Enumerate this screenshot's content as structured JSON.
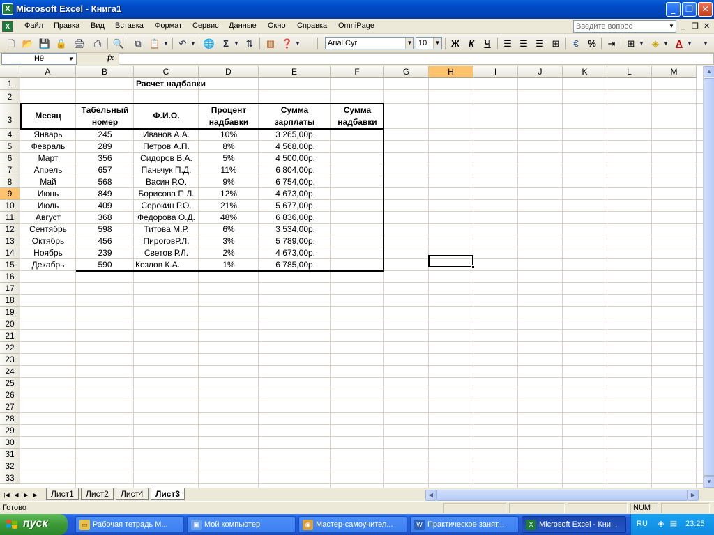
{
  "window": {
    "title": "Microsoft Excel - Книга1",
    "app_icon": "excel-icon"
  },
  "menu": {
    "items": [
      "Файл",
      "Правка",
      "Вид",
      "Вставка",
      "Формат",
      "Сервис",
      "Данные",
      "Окно",
      "Справка",
      "OmniPage"
    ],
    "ask_placeholder": "Введите вопрос"
  },
  "toolbar": {
    "font_name": "Arial Cyr",
    "font_size": "10",
    "bold": "Ж",
    "italic": "К",
    "underline": "Ч",
    "sum": "Σ",
    "percent": "%"
  },
  "formula_bar": {
    "name_box": "H9",
    "fx": "fx",
    "content": ""
  },
  "columns": [
    "A",
    "B",
    "C",
    "D",
    "E",
    "F",
    "G",
    "H",
    "I",
    "J",
    "K",
    "L",
    "M"
  ],
  "selected_column": "H",
  "selected_row": 9,
  "rows": [
    "1",
    "2",
    "3",
    "4",
    "5",
    "6",
    "7",
    "8",
    "9",
    "10",
    "11",
    "12",
    "13",
    "14",
    "15",
    "16",
    "17",
    "18",
    "19",
    "20",
    "21",
    "22",
    "23",
    "24",
    "25",
    "26",
    "27",
    "28",
    "29",
    "30",
    "31",
    "32",
    "33"
  ],
  "sheet": {
    "title": "Расчет надбавки",
    "headers": {
      "month": "Месяц",
      "tab_num": [
        "Табельный",
        "номер"
      ],
      "fio": "Ф.И.О.",
      "percent": [
        "Процент",
        "надбавки"
      ],
      "salary": [
        "Сумма",
        "зарплаты"
      ],
      "bonus": [
        "Сумма",
        "надбавки"
      ]
    },
    "records": [
      [
        "Январь",
        "245",
        "Иванов А.А.",
        "10%",
        "3 265,00р."
      ],
      [
        "Февраль",
        "289",
        "Петров А.П.",
        "8%",
        "4 568,00р."
      ],
      [
        "Март",
        "356",
        "Сидоров В.А.",
        "5%",
        "4 500,00р."
      ],
      [
        "Апрель",
        "657",
        "Паньчук П.Д.",
        "11%",
        "6 804,00р."
      ],
      [
        "Май",
        "568",
        "Васин Р.О.",
        "9%",
        "6 754,00р."
      ],
      [
        "Июнь",
        "849",
        "Борисова П.Л.",
        "12%",
        "4 673,00р."
      ],
      [
        "Июль",
        "409",
        "Сорокин Р.О.",
        "21%",
        "5 677,00р."
      ],
      [
        "Август",
        "368",
        "Федорова О.Д.",
        "48%",
        "6 836,00р."
      ],
      [
        "Сентябрь",
        "598",
        "Титова М.Р.",
        "6%",
        "3 534,00р."
      ],
      [
        "Октябрь",
        "456",
        "ПироговР.Л.",
        "3%",
        "5 789,00р."
      ],
      [
        "Ноябрь",
        "239",
        "Светов Р.Л.",
        "2%",
        "4 673,00р."
      ],
      [
        "Декабрь",
        "590",
        "Козлов К.А.",
        "1%",
        "6 785,00р."
      ]
    ]
  },
  "tabs": [
    "Лист1",
    "Лист2",
    "Лист4",
    "Лист3"
  ],
  "active_tab": "Лист3",
  "status": {
    "ready": "Готово",
    "num": "NUM"
  },
  "taskbar": {
    "start": "пуск",
    "tasks": [
      "Рабочая тетрадь М...",
      "Мой компьютер",
      "Мастер-самоучител...",
      "Практическое занят...",
      "Microsoft Excel - Кни..."
    ],
    "lang": "RU",
    "clock": "23:25"
  }
}
